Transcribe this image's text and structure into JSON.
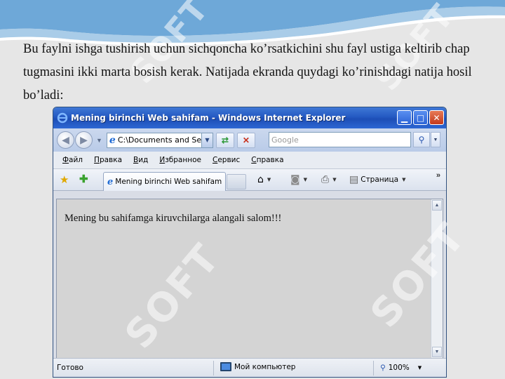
{
  "slide": {
    "paragraph": "Bu faylni ishga tushirish uchun sichqoncha ko’rsatkichini shu fayl ustiga keltirib chap tugmasini ikki marta bosish kerak. Natijada ekranda quydagi ko’rinishdagi natija hosil bo’ladi:",
    "watermark_text": "SOFT"
  },
  "window": {
    "title": "Mening birinchi Web sahifam - Windows Internet Explorer",
    "buttons": {
      "minimize": "▁",
      "maximize": "□",
      "close": "✕"
    }
  },
  "address_bar": {
    "url": "C:\\Documents and Se",
    "search_placeholder": "Google"
  },
  "menu": {
    "items": [
      "Файл",
      "Правка",
      "Вид",
      "Избранное",
      "Сервис",
      "Справка"
    ]
  },
  "tabs": {
    "active_tab": "Mening birinchi Web sahifam",
    "page_menu": "Страница",
    "more": "»"
  },
  "page": {
    "content_text": "Mening bu sahifamga kiruvchilarga alangali salom!!!"
  },
  "status": {
    "left": "Готово",
    "zone": "Мой компьютер",
    "zoom": "100%"
  },
  "colors": {
    "titlebar": "#2459c2",
    "slide_bg": "#e6e6e6",
    "watermark": "#ffffff"
  }
}
